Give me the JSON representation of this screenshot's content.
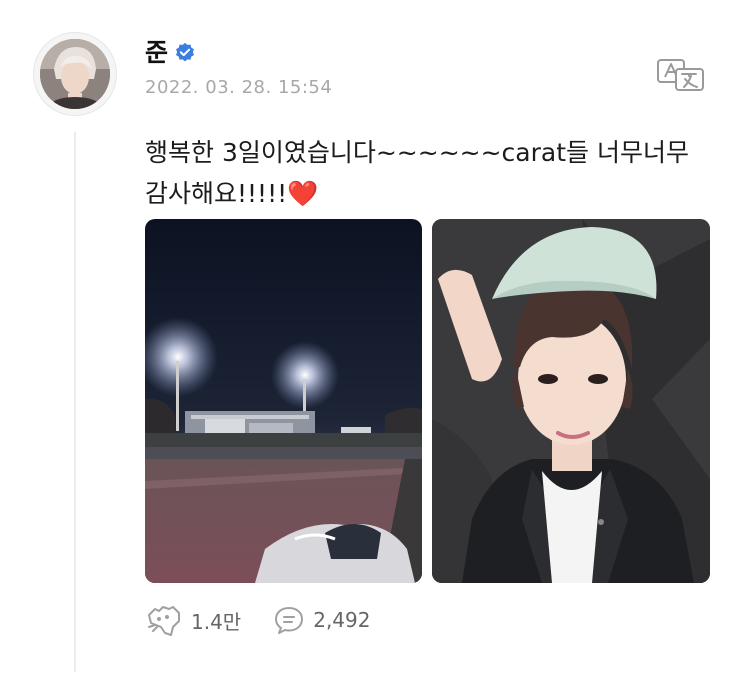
{
  "post": {
    "author": "준",
    "verified_icon": "verified-badge-icon",
    "timestamp": "2022. 03. 28. 15:54",
    "translate_icon": "translate-icon",
    "text_line1": "행복한 3일이였습니다~~~~~~carat들 너무너무",
    "text_line2": "감사해요!!!!!",
    "emoji": "❤️"
  },
  "images": [
    {
      "icon": "stadium-night-photo"
    },
    {
      "icon": "selfie-photo"
    }
  ],
  "actions": {
    "likes_icon": "like-icon",
    "likes": "1.4만",
    "comments_icon": "comment-icon",
    "comments": "2,492"
  },
  "colors": {
    "verified": "#3a7ee0",
    "text": "#1c1c1c",
    "muted": "#a8a8a8",
    "heart": "#e0303f"
  }
}
